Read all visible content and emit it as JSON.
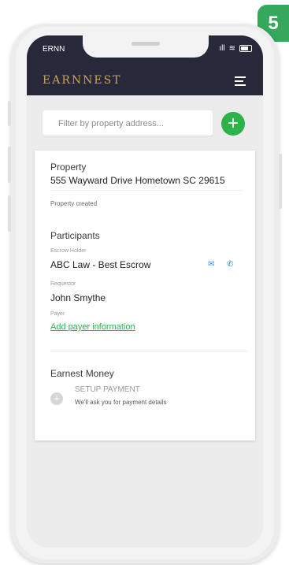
{
  "status_bar": {
    "carrier": "ERNN",
    "signal": "ıll",
    "wifi": "≋"
  },
  "app": {
    "logo": "EARNNEST"
  },
  "filter": {
    "placeholder": "Filter by property address..."
  },
  "add_button": {
    "label": "+"
  },
  "property": {
    "heading": "Property",
    "address": "555 Wayward Drive Hometown SC 29615",
    "status": "Property created"
  },
  "participants": {
    "heading": "Participants",
    "escrow_holder_label": "Escrow Holder",
    "escrow_holder_value": "ABC Law - Best Escrow",
    "requestor_label": "Requestor",
    "requestor_value": "John Smythe",
    "payer_label": "Payer",
    "payer_link": "Add payer information"
  },
  "earnest_money": {
    "heading": "Earnest Money",
    "setup_title": "SETUP PAYMENT",
    "setup_desc": "We'll ask you for payment details",
    "setup_icon": "+"
  },
  "badge": {
    "number": "5"
  },
  "icons": {
    "mail": "✉",
    "phone": "✆"
  },
  "colors": {
    "header": "#27293b",
    "brand_gold": "#c8a35a",
    "accent_green": "#2db34a",
    "contact_blue": "#2f8fe0",
    "badge_green": "#35a85b"
  }
}
